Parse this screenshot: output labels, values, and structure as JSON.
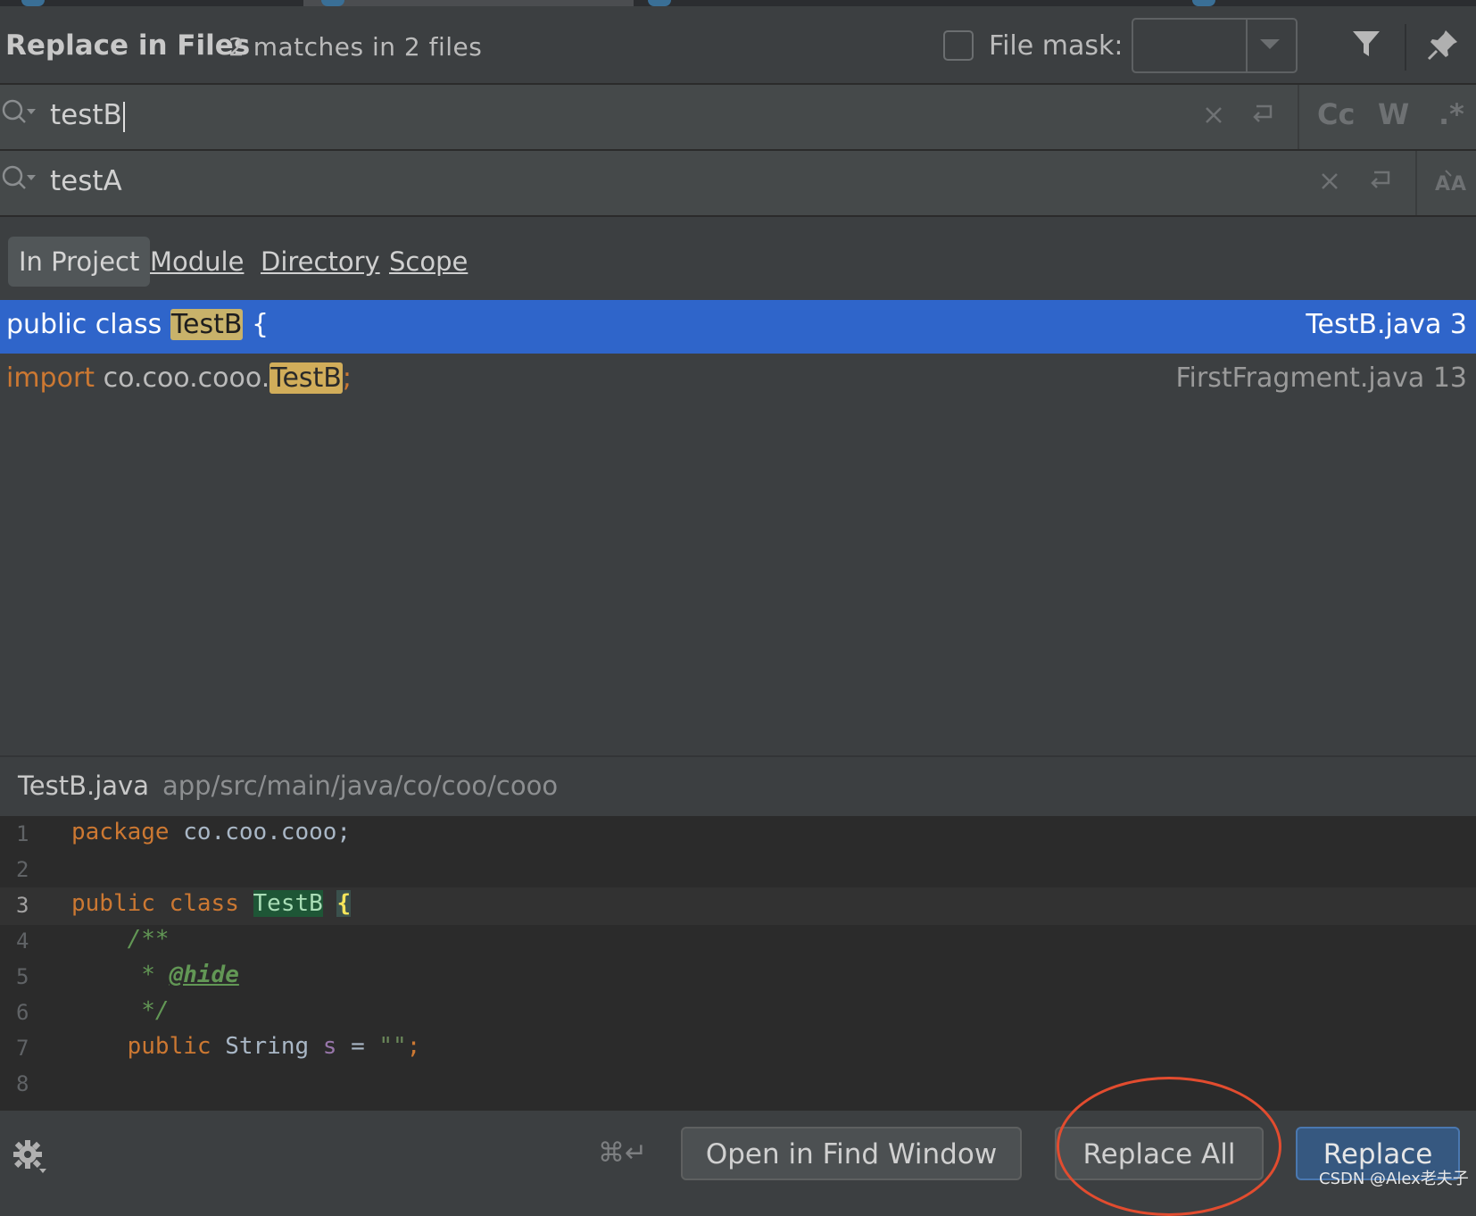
{
  "colors": {
    "accent_selected": "#2f65ca",
    "match_highlight": "#c8b26a",
    "annotation_circle": "#e24c2f",
    "editor_bg": "#2b2b2b",
    "panel_bg": "#3c3f41"
  },
  "header": {
    "title": "Replace in Files",
    "summary": "2 matches in 2 files",
    "file_mask_label": "File mask:",
    "file_mask_checked": false,
    "file_mask_value": "",
    "icons": [
      "filter-icon",
      "pin-icon"
    ]
  },
  "search": {
    "find_value": "testB",
    "replace_value": "testA",
    "find_icons": [
      "search-history-icon",
      "clear-icon",
      "newline-icon"
    ],
    "options": {
      "case": "Cc",
      "words": "W",
      "regex": ".*"
    },
    "replace_icons": [
      "search-history-icon",
      "clear-icon",
      "newline-icon",
      "preserve-case-icon"
    ]
  },
  "scopes": {
    "in_project": "In Project",
    "module": "Module",
    "directory": "Directory",
    "scope": "Scope",
    "active": "In Project"
  },
  "results": [
    {
      "prefix": "public class ",
      "match": "TestB",
      "suffix": " {",
      "file": "TestB.java 3",
      "selected": true
    },
    {
      "keyword": "import",
      "prefix": " co.coo.cooo.",
      "match": "TestB",
      "suffix": ";",
      "file": "FirstFragment.java 13",
      "selected": false
    }
  ],
  "preview": {
    "file_name": "TestB.java",
    "file_path": "app/src/main/java/co/coo/cooo",
    "current_line": 3,
    "lines": {
      "l1": {
        "num": "1",
        "kw": "package",
        "rest": " co.coo.cooo;"
      },
      "l2": {
        "num": "2"
      },
      "l3": {
        "num": "3",
        "kw1": "public",
        "kw2": "class",
        "cls": "TestB",
        "brace": "{"
      },
      "l4": {
        "num": "4",
        "text": "    /**"
      },
      "l5": {
        "num": "5",
        "star": "     * ",
        "tag": "@hide"
      },
      "l6": {
        "num": "6",
        "text": "     */"
      },
      "l7": {
        "num": "7",
        "kw": "public",
        "type": " String ",
        "var": "s",
        "eq": " = ",
        "str": "\"\"",
        "semi": ";"
      },
      "l8": {
        "num": "8"
      }
    }
  },
  "footer": {
    "shortcut": "⌘↵",
    "open_in_find_window": "Open in Find Window",
    "replace_all": "Replace All",
    "replace": "Replace",
    "watermark": "CSDN @Alex老夫子"
  }
}
